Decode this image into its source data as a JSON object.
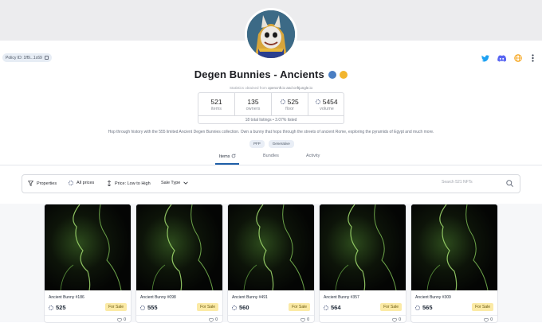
{
  "collection": {
    "policy_label": "Policy ID: 1ff9...1c69",
    "title": "Degen Bunnies - Ancients",
    "subtitle_prefix": "Statistics obtained from",
    "subtitle_sources": "opencnft.io and cnftjungle.io",
    "description": "Hop through history with the 555 limited Ancient Degen Bunnies collection. Own a bunny that hops through the streets of ancient Rome, exploring the pyramids of Egypt and much more.",
    "tags": [
      "PFP",
      "Generative"
    ]
  },
  "stats": {
    "items": {
      "value": "521",
      "label": "items"
    },
    "owners": {
      "value": "135",
      "label": "owners"
    },
    "floor": {
      "value": "525",
      "label": "floor"
    },
    "volume": {
      "value": "5454",
      "label": "volume"
    },
    "listed": "18 total listings • 3.07% listed"
  },
  "tabs": [
    "Items",
    "Bundles",
    "Activity"
  ],
  "toolbar": {
    "properties": "Properties",
    "all_prices": "All prices",
    "sort": "Price: Low to High",
    "sale_type": "Sale Type",
    "search_placeholder": "Search 521 NFTs"
  },
  "icons": [
    "twitter-icon",
    "discord-icon",
    "globe-icon",
    "more-icon",
    "refresh-icon",
    "filter-icon",
    "search-icon",
    "heart-icon"
  ],
  "colors": {
    "twitter": "#1da1f2",
    "discord": "#5865f2",
    "web": "#f59e0b",
    "accent": "#1f5fa8",
    "sale_badge": "#fbeaa6"
  },
  "nfts": [
    {
      "name": "Ancient Bunny #186",
      "price": "525",
      "status": "For Sale",
      "likes": "0"
    },
    {
      "name": "Ancient Bunny #098",
      "price": "555",
      "status": "For Sale",
      "likes": "0"
    },
    {
      "name": "Ancient Bunny #491",
      "price": "560",
      "status": "For Sale",
      "likes": "0"
    },
    {
      "name": "Ancient Bunny #357",
      "price": "564",
      "status": "For Sale",
      "likes": "0"
    },
    {
      "name": "Ancient Bunny #309",
      "price": "565",
      "status": "For Sale",
      "likes": "0"
    }
  ]
}
